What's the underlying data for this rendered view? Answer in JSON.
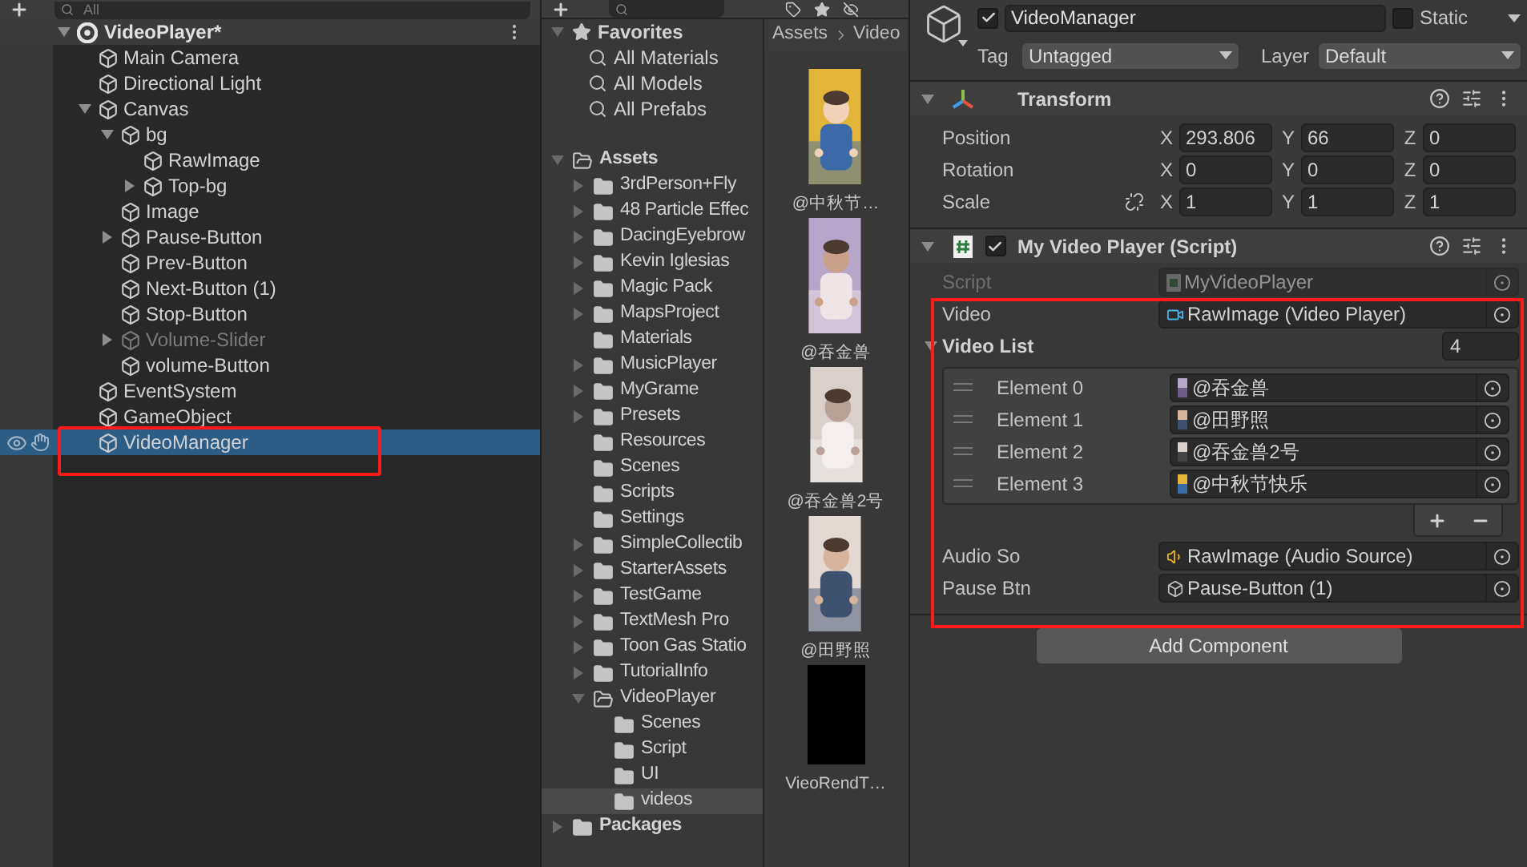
{
  "hierarchy": {
    "search_placeholder": "All",
    "scene": {
      "name": "VideoPlayer*",
      "expanded": true
    },
    "items": [
      {
        "name": "Main Camera",
        "selected": false,
        "disabled": false
      },
      {
        "name": "Directional Light",
        "selected": false,
        "disabled": false
      },
      {
        "name": "Canvas",
        "selected": false,
        "disabled": false,
        "expanded": true,
        "children": [
          {
            "name": "bg",
            "selected": false,
            "disabled": false,
            "expanded": true,
            "children": [
              {
                "name": "RawImage",
                "selected": false,
                "disabled": false
              },
              {
                "name": "Top-bg",
                "selected": false,
                "disabled": false,
                "expanded": false
              }
            ]
          },
          {
            "name": "Image",
            "selected": false,
            "disabled": false
          },
          {
            "name": "Pause-Button",
            "selected": false,
            "disabled": false,
            "expanded": false
          },
          {
            "name": "Prev-Button",
            "selected": false,
            "disabled": false
          },
          {
            "name": "Next-Button  (1)",
            "selected": false,
            "disabled": false
          },
          {
            "name": "Stop-Button",
            "selected": false,
            "disabled": false
          },
          {
            "name": "Volume-Slider",
            "selected": false,
            "disabled": true,
            "expanded": false
          },
          {
            "name": "volume-Button",
            "selected": false,
            "disabled": false
          }
        ]
      },
      {
        "name": "EventSystem",
        "selected": false,
        "disabled": false
      },
      {
        "name": "GameObject",
        "selected": false,
        "disabled": false
      },
      {
        "name": "VideoManager",
        "selected": true,
        "disabled": false
      }
    ]
  },
  "project": {
    "favorites": {
      "label": "Favorites",
      "expanded": true,
      "items": [
        "All Materials",
        "All Models",
        "All Prefabs"
      ]
    },
    "tree": [
      {
        "name": "Assets",
        "expanded": true,
        "selected": false,
        "children": [
          {
            "name": "3rdPerson+Fly",
            "expanded": false,
            "selected": false
          },
          {
            "name": "48 Particle Effec",
            "expanded": false,
            "selected": false
          },
          {
            "name": "DacingEyebrow",
            "expanded": false,
            "selected": false
          },
          {
            "name": "Kevin Iglesias",
            "expanded": false,
            "selected": false
          },
          {
            "name": "Magic Pack",
            "expanded": false,
            "selected": false
          },
          {
            "name": "MapsProject",
            "expanded": false,
            "selected": false
          },
          {
            "name": "Materials",
            "selected": false
          },
          {
            "name": "MusicPlayer",
            "expanded": false,
            "selected": false
          },
          {
            "name": "MyGrame",
            "expanded": false,
            "selected": false
          },
          {
            "name": "Presets",
            "expanded": false,
            "selected": false
          },
          {
            "name": "Resources",
            "selected": false
          },
          {
            "name": "Scenes",
            "selected": false
          },
          {
            "name": "Scripts",
            "selected": false
          },
          {
            "name": "Settings",
            "selected": false
          },
          {
            "name": "SimpleCollectib",
            "expanded": false,
            "selected": false
          },
          {
            "name": "StarterAssets",
            "expanded": false,
            "selected": false
          },
          {
            "name": "TestGame",
            "expanded": false,
            "selected": false
          },
          {
            "name": "TextMesh Pro",
            "expanded": false,
            "selected": false
          },
          {
            "name": "Toon Gas Statio",
            "expanded": false,
            "selected": false
          },
          {
            "name": "TutorialInfo",
            "expanded": false,
            "selected": false
          },
          {
            "name": "VideoPlayer",
            "expanded": true,
            "selected": false,
            "children": [
              {
                "name": "Scenes",
                "selected": false
              },
              {
                "name": "Script",
                "selected": false
              },
              {
                "name": "UI",
                "selected": false
              },
              {
                "name": "videos",
                "selected": true
              }
            ]
          }
        ]
      },
      {
        "name": "Packages",
        "expanded": false,
        "selected": false
      }
    ],
    "breadcrumb": [
      "Assets",
      "Video"
    ],
    "assets": [
      {
        "label": "@中秋节…",
        "kind": "picture"
      },
      {
        "label": "@吞金兽",
        "kind": "picture"
      },
      {
        "label": "@吞金兽2号",
        "kind": "picture"
      },
      {
        "label": "@田野照",
        "kind": "picture"
      },
      {
        "label": "VieoRendT…",
        "kind": "render_texture"
      }
    ]
  },
  "inspector": {
    "object": {
      "active": true,
      "name": "VideoManager",
      "static": false,
      "static_label": "Static",
      "tag_label": "Tag",
      "tag": "Untagged",
      "layer_label": "Layer",
      "layer": "Default"
    },
    "components": [
      {
        "kind": "transform",
        "title": "Transform",
        "expanded": true,
        "rows": [
          {
            "kind": "position",
            "label": "Position",
            "values": [
              {
                "axis": "X",
                "value": "293.806"
              },
              {
                "axis": "Y",
                "value": "66"
              },
              {
                "axis": "Z",
                "value": "0"
              }
            ]
          },
          {
            "kind": "rotation",
            "label": "Rotation",
            "values": [
              {
                "axis": "X",
                "value": "0"
              },
              {
                "axis": "Y",
                "value": "0"
              },
              {
                "axis": "Z",
                "value": "0"
              }
            ]
          },
          {
            "kind": "scale",
            "label": "Scale",
            "values": [
              {
                "axis": "X",
                "value": "1"
              },
              {
                "axis": "Y",
                "value": "1"
              },
              {
                "axis": "Z",
                "value": "1"
              }
            ]
          }
        ]
      },
      {
        "kind": "script",
        "title": "My Video Player (Script)",
        "enabled": true,
        "expanded": true,
        "fields": [
          {
            "kind": "script_ref",
            "label": "Script",
            "value": "MyVideoPlayer",
            "disabled": true
          },
          {
            "kind": "video_ref",
            "label": "Video",
            "value": "RawImage (Video Player)",
            "disabled": false
          },
          {
            "kind": "list",
            "label": "Video List",
            "expanded": true,
            "count": "4",
            "elements": [
              {
                "label": "Element 0",
                "value": "@吞金兽"
              },
              {
                "label": "Element 1",
                "value": "@田野照"
              },
              {
                "label": "Element 2",
                "value": "@吞金兽2号"
              },
              {
                "label": "Element 3",
                "value": "@中秋节快乐"
              }
            ]
          },
          {
            "kind": "audio_ref",
            "label": "Audio So",
            "value": "RawImage (Audio Source)",
            "disabled": false
          },
          {
            "kind": "object_ref",
            "label": "Pause Btn",
            "value": "Pause-Button (1)",
            "disabled": false
          }
        ]
      }
    ],
    "add_component": "Add Component"
  }
}
